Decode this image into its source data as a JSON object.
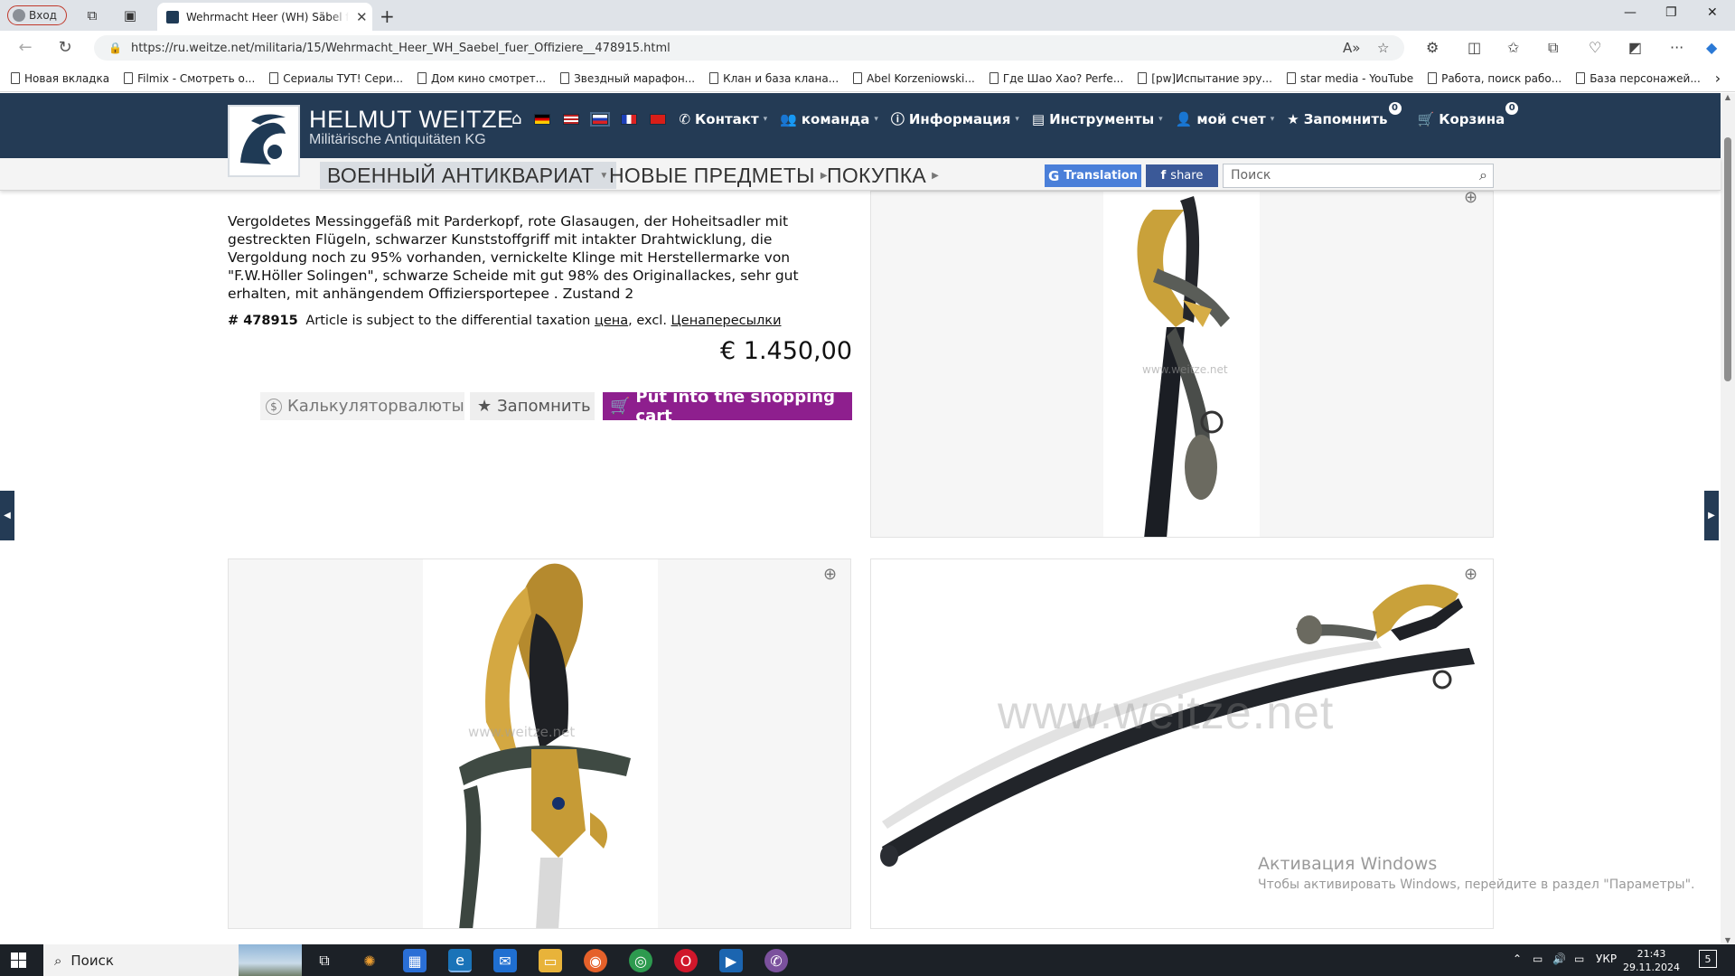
{
  "browser": {
    "profile_label": "Вход",
    "tab_title": "Wehrmacht Heer (WH) Säbel für Offiziere",
    "url": "https://ru.weitze.net/militaria/15/Wehrmacht_Heer_WH_Saebel_fuer_Offiziere__478915.html",
    "bookmarks": [
      "Новая вкладка",
      "Filmix - Смотреть о...",
      "Сериалы ТУТ! Сери...",
      "Дом кино смотрет...",
      "Звездный марафон...",
      "Клан и база клана...",
      "Abel Korzeniowski...",
      "Где Шао Хао? Perfe...",
      "[pw]Испытание эру...",
      "star media - YouTube",
      "Работа, поиск рабо...",
      "База персонажей..."
    ]
  },
  "header": {
    "brand_name": "HELMUT WEITZE",
    "brand_sub": "Militärische Antiquitäten KG",
    "nav": {
      "contact": "Контакт",
      "team": "команда",
      "info": "Информация",
      "tools": "Инструменты",
      "account": "мой счет",
      "remember": "Запомнить",
      "remember_count": "0",
      "cart": "Корзина",
      "cart_count": "0"
    },
    "subnav": {
      "military": "ВОЕННЫЙ АНТИКВАРИАТ",
      "new_items": "НОВЫЕ ПРЕДМЕТЫ",
      "purchase": "ПОКУПКА"
    },
    "translation_label": "Translation",
    "share_label": "share",
    "search_placeholder": "Поиск"
  },
  "product": {
    "description": "Vergoldetes Messinggefäß mit Parderkopf, rote Glasaugen, der Hoheitsadler mit gestreckten Flügeln, schwarzer Kunststoffgriff mit intakter Drahtwicklung, die Vergoldung noch zu 95% vorhanden, vernickelte Klinge mit Herstellermarke von \"F.W.Höller Solingen\", schwarze Scheide mit gut 98% des Originallackes, sehr gut erhalten, mit anhängendem Offiziersportepee . Zustand 2",
    "article_no": "# 478915",
    "tax_text": "Article is subject to the differential taxation",
    "price_link": "цена",
    "excl_text": ", excl.",
    "shipping_link": "Ценапересылки",
    "price": "€ 1.450,00",
    "calc_label": "Калькуляторвалюты",
    "remember_label": "Запомнить",
    "cart_label": "Put into the shopping cart",
    "watermark": "www.weitze.net"
  },
  "windows_activation": {
    "title": "Активация Windows",
    "subtitle": "Чтобы активировать Windows, перейдите в раздел \"Параметры\"."
  },
  "taskbar": {
    "search_label": "Поиск",
    "lang": "УКР",
    "time": "21:43",
    "date": "29.11.2024",
    "notifications": "5"
  }
}
